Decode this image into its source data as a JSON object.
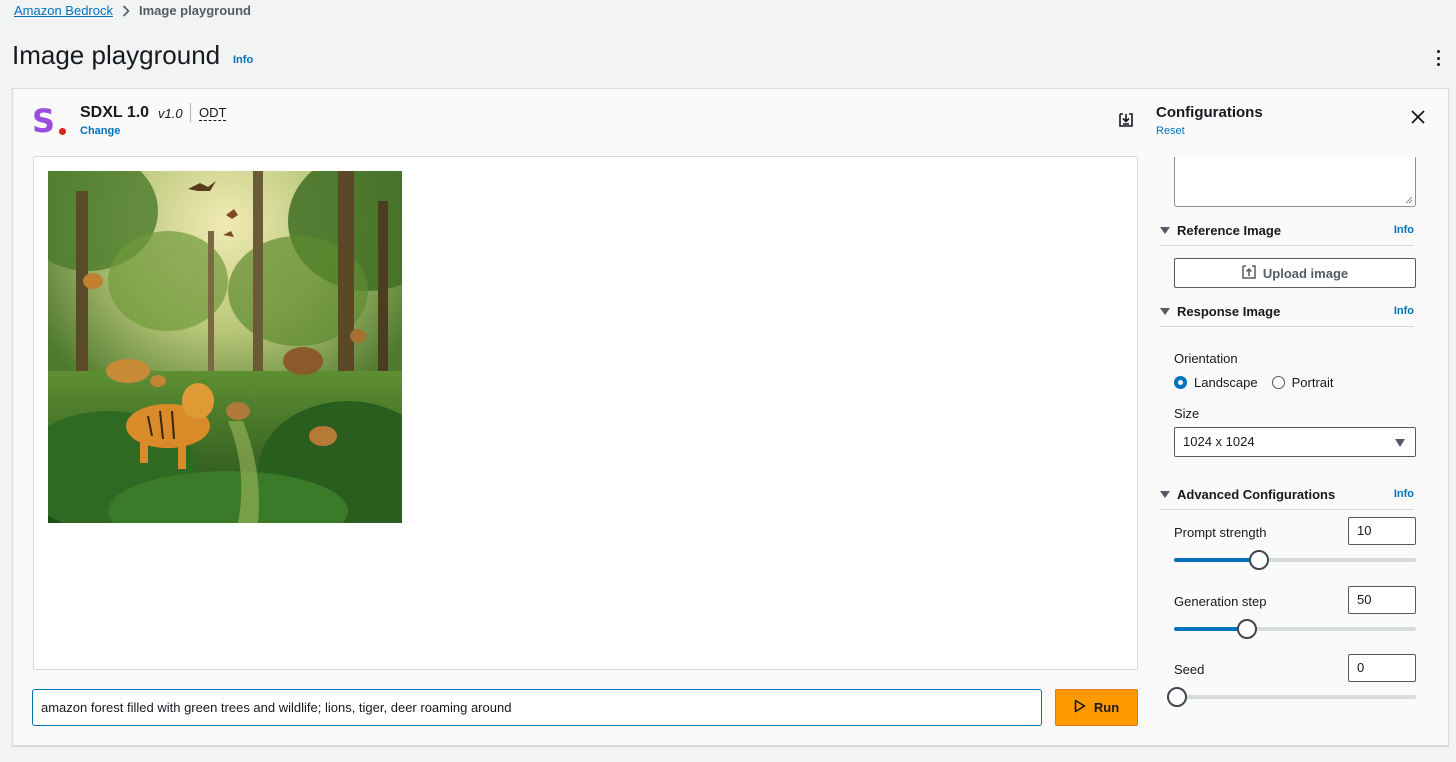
{
  "breadcrumb": {
    "root": "Amazon Bedrock",
    "current": "Image playground"
  },
  "page": {
    "title": "Image playground",
    "info": "Info"
  },
  "model": {
    "name": "SDXL 1.0",
    "version": "v1.0",
    "tag": "ODT",
    "change": "Change"
  },
  "prompt": {
    "value": "amazon forest filled with green trees and wildlife; lions, tiger, deer roaming around"
  },
  "run_label": "Run",
  "config": {
    "title": "Configurations",
    "reset": "Reset",
    "reference": {
      "label": "Reference Image",
      "info": "Info",
      "upload": "Upload image"
    },
    "response": {
      "label": "Response Image",
      "info": "Info",
      "orientation_label": "Orientation",
      "options": [
        "Landscape",
        "Portrait"
      ],
      "selected": "Landscape",
      "size_label": "Size",
      "size_value": "1024 x 1024"
    },
    "advanced": {
      "label": "Advanced Configurations",
      "info": "Info",
      "prompt_strength": {
        "label": "Prompt strength",
        "value": "10",
        "level": 0.35
      },
      "generation_step": {
        "label": "Generation step",
        "value": "50",
        "level": 0.3
      },
      "seed": {
        "label": "Seed",
        "value": "0",
        "level": 0
      }
    }
  },
  "colors": {
    "link": "#0073bb",
    "run": "#ff9900",
    "slider_fill": "#0073bb"
  }
}
